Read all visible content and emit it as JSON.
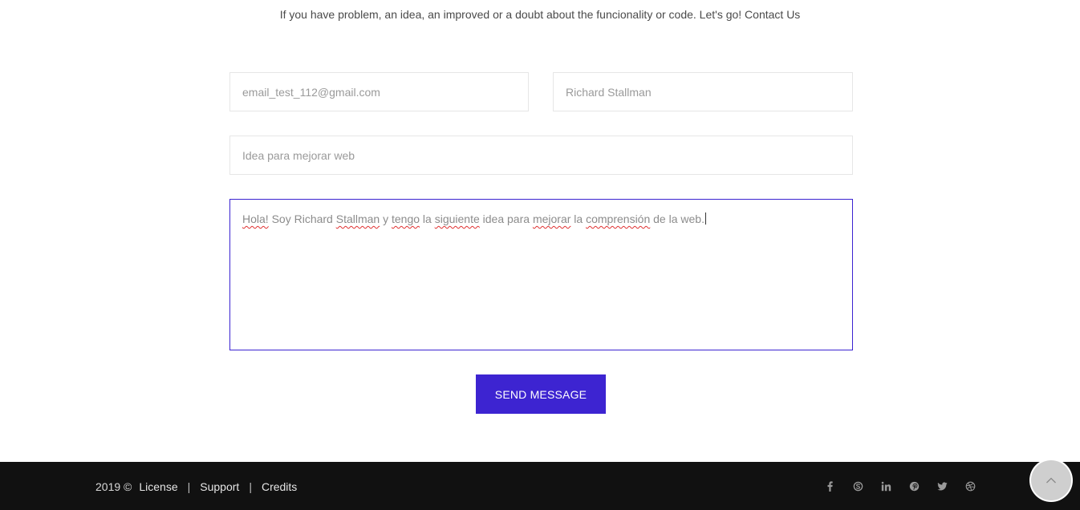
{
  "intro": {
    "text": "If you have problem, an idea, an improved or a doubt about the funcionality or code. Let's go! Contact Us"
  },
  "form": {
    "email_value": "email_test_112@gmail.com",
    "name_value": "Richard Stallman",
    "subject_value": "Idea para mejorar web",
    "message_words": [
      "Hola!",
      "Soy",
      "Richard",
      "Stallman",
      "y",
      "tengo",
      "la",
      "siguiente",
      "idea",
      "para",
      "mejorar",
      "la",
      "comprensión",
      "de",
      "la",
      "web."
    ],
    "send_label": "SEND MESSAGE"
  },
  "footer": {
    "year": "2019 ©",
    "separator": "|",
    "links": [
      "License",
      "Support",
      "Credits"
    ],
    "social_icons": [
      "facebook-icon",
      "skype-icon",
      "linkedin-icon",
      "pinterest-icon",
      "twitter-icon",
      "dribbble-icon"
    ]
  },
  "colors": {
    "accent": "#3d24d1",
    "footer_bg": "#111111",
    "to_top_bg": "#cfcfcf"
  },
  "scroll_top_icon": "chevron-up-icon"
}
